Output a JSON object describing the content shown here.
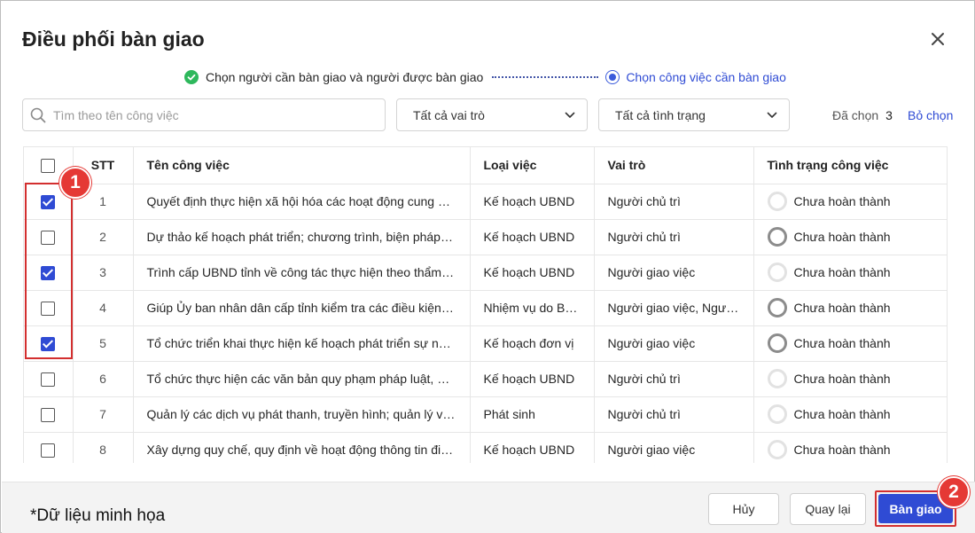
{
  "dialog": {
    "title": "Điều phối bàn giao"
  },
  "stepper": {
    "step1": "Chọn người cần bàn giao và người được bàn giao",
    "step2": "Chọn công việc cần bàn giao"
  },
  "filters": {
    "search_placeholder": "Tìm theo tên công việc",
    "role_select": "Tất cả vai trò",
    "status_select": "Tất cả tình trạng",
    "selected_label": "Đã chọn",
    "selected_count": "3",
    "deselect_label": "Bỏ chọn"
  },
  "table": {
    "headers": {
      "stt": "STT",
      "name": "Tên công việc",
      "type": "Loại việc",
      "role": "Vai trò",
      "status": "Tình trạng công việc"
    },
    "rows": [
      {
        "checked": true,
        "stt": "1",
        "name": "Quyết định thực hiện xã hội hóa các hoạt động cung cấp dịch vụ",
        "type": "Kế hoạch UBND",
        "role": "Người chủ trì",
        "status": "Chưa hoàn thành",
        "progress": 0
      },
      {
        "checked": false,
        "stt": "2",
        "name": "Dự thảo kế hoạch phát triển; chương trình, biện pháp thực hiện",
        "type": "Kế hoạch UBND",
        "role": "Người chủ trì",
        "status": "Chưa hoàn thành",
        "progress": 1
      },
      {
        "checked": true,
        "stt": "3",
        "name": "Trình cấp UBND tỉnh về công tác thực hiện theo thẩm quyền",
        "type": "Kế hoạch UBND",
        "role": "Người giao việc",
        "status": "Chưa hoàn thành",
        "progress": 0
      },
      {
        "checked": false,
        "stt": "4",
        "name": "Giúp Ủy ban nhân dân cấp tỉnh kiểm tra các điều kiện hoạt động",
        "type": "Nhiệm vụ do Bộ giao",
        "role": "Người giao việc, Người chủ trì",
        "status": "Chưa hoàn thành",
        "progress": 1
      },
      {
        "checked": true,
        "stt": "5",
        "name": "Tổ chức triển khai thực hiện kế hoạch phát triển sự nghiệp",
        "type": "Kế hoạch đơn vị",
        "role": "Người giao việc",
        "status": "Chưa hoàn thành",
        "progress": 1
      },
      {
        "checked": false,
        "stt": "6",
        "name": "Tổ chức thực hiện các văn bản quy phạm pháp luật, quy hoạch",
        "type": "Kế hoạch UBND",
        "role": "Người chủ trì",
        "status": "Chưa hoàn thành",
        "progress": 0
      },
      {
        "checked": false,
        "stt": "7",
        "name": "Quản lý các dịch vụ phát thanh, truyền hình; quản lý việc cung cấp",
        "type": "Phát sinh",
        "role": "Người chủ trì",
        "status": "Chưa hoàn thành",
        "progress": 0
      },
      {
        "checked": false,
        "stt": "8",
        "name": "Xây dựng quy chế, quy định về hoạt động thông tin điện tử",
        "type": "Kế hoạch UBND",
        "role": "Người giao việc",
        "status": "Chưa hoàn thành",
        "progress": 0
      }
    ]
  },
  "annotations": {
    "badge1": "1",
    "badge2": "2"
  },
  "footer": {
    "note": "*Dữ liệu minh họa",
    "cancel": "Hủy",
    "back": "Quay lại",
    "handover": "Bàn giao"
  },
  "colors": {
    "primary": "#2f4bd4",
    "success": "#2eb85c",
    "annotation_red": "#e53935"
  }
}
